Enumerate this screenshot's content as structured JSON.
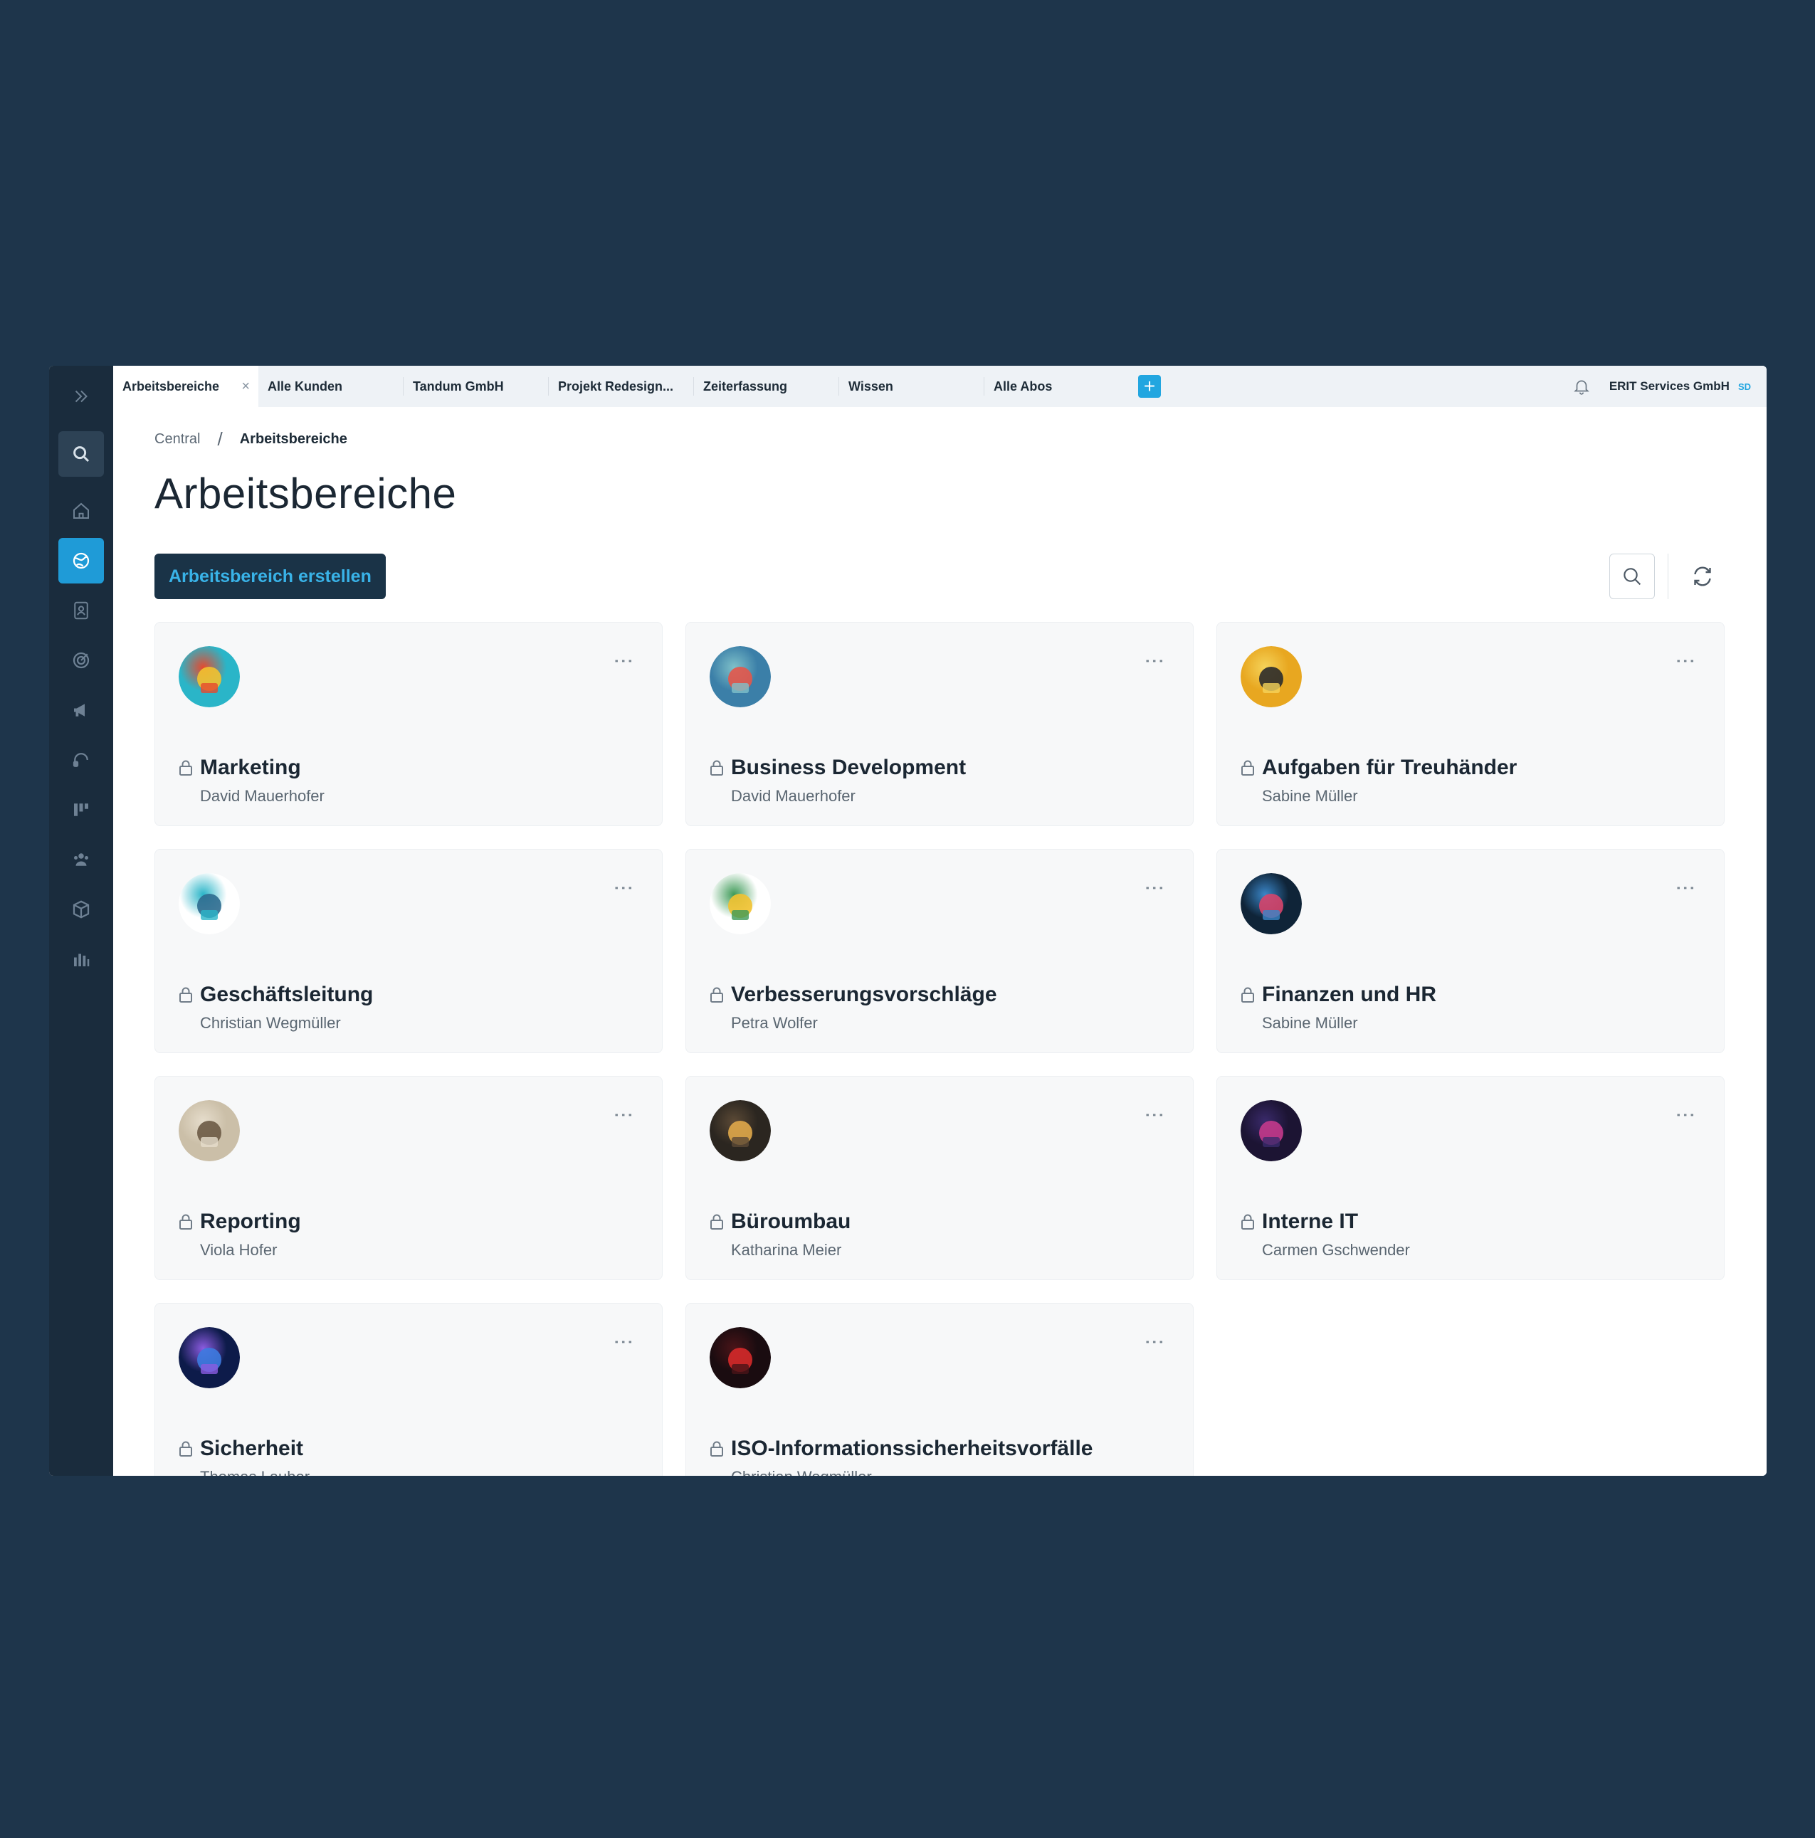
{
  "tabs": [
    {
      "label": "Arbeitsbereiche",
      "active": true,
      "closable": true
    },
    {
      "label": "Alle Kunden"
    },
    {
      "label": "Tandum GmbH"
    },
    {
      "label": "Projekt Redesign..."
    },
    {
      "label": "Zeiterfassung"
    },
    {
      "label": "Wissen"
    },
    {
      "label": "Alle Abos"
    }
  ],
  "tab_close": "×",
  "tab_add": "+",
  "header": {
    "company": "ERIT Services GmbH",
    "user_initials": "SD"
  },
  "breadcrumb": {
    "root": "Central",
    "separator": "/",
    "current": "Arbeitsbereiche"
  },
  "page_title": "Arbeitsbereiche",
  "toolbar": {
    "create_label": "Arbeitsbereich erstellen"
  },
  "card_menu": "⋮",
  "workspaces": [
    {
      "title": "Marketing",
      "owner": "David Mauerhofer",
      "avatar": "megaphone-illustration",
      "colors": [
        "#2ab5c8",
        "#f2c230",
        "#e6492e"
      ]
    },
    {
      "title": "Business Development",
      "owner": "David Mauerhofer",
      "avatar": "team-illustration",
      "colors": [
        "#3b7fa8",
        "#e4574a",
        "#7fc1c9"
      ]
    },
    {
      "title": "Aufgaben für Treuhänder",
      "owner": "Sabine Müller",
      "avatar": "calculator-illustration",
      "colors": [
        "#e8a720",
        "#2b2b2b",
        "#f5d35a"
      ]
    },
    {
      "title": "Geschäftsleitung",
      "owner": "Christian Wegmüller",
      "avatar": "presentation-illustration",
      "colors": [
        "#ffffff",
        "#2e6b8f",
        "#2ab5c8"
      ]
    },
    {
      "title": "Verbesserungsvorschläge",
      "owner": "Petra Wolfer",
      "avatar": "idea-illustration",
      "colors": [
        "#ffffff",
        "#f2c230",
        "#3d9a57"
      ]
    },
    {
      "title": "Finanzen und HR",
      "owner": "Sabine Müller",
      "avatar": "finance-chart-photo",
      "colors": [
        "#0f2438",
        "#d6456b",
        "#3a86c8"
      ]
    },
    {
      "title": "Reporting",
      "owner": "Viola Hofer",
      "avatar": "paper-stack-photo",
      "colors": [
        "#cbbfa8",
        "#6b5a45",
        "#e6ddcc"
      ]
    },
    {
      "title": "Büroumbau",
      "owner": "Katharina Meier",
      "avatar": "office-photo",
      "colors": [
        "#2b2620",
        "#e0a94a",
        "#5c4a36"
      ]
    },
    {
      "title": "Interne IT",
      "owner": "Carmen Gschwender",
      "avatar": "computer-photo",
      "colors": [
        "#1c1433",
        "#c43a8c",
        "#3a2a6b"
      ]
    },
    {
      "title": "Sicherheit",
      "owner": "Thomas Lauber",
      "avatar": "shield-photo",
      "colors": [
        "#0d1b4a",
        "#3d7be0",
        "#8b5be0"
      ]
    },
    {
      "title": "ISO-Informationssicherheitsvorfälle",
      "owner": "Christian Wegmüller",
      "avatar": "security-lock-photo",
      "colors": [
        "#1a0c10",
        "#d62a2a",
        "#4a1418"
      ]
    }
  ]
}
